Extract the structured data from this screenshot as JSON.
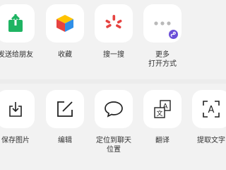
{
  "share_row": {
    "items": [
      {
        "label": "发送给朋友",
        "icon": "send-to-friend-icon"
      },
      {
        "label": "收藏",
        "icon": "favorite-cube-icon"
      },
      {
        "label": "搜一搜",
        "icon": "search-one-search-icon"
      },
      {
        "label_line1": "更多",
        "label_line2": "打开方式",
        "icon": "more-open-with-icon"
      }
    ]
  },
  "action_row": {
    "items": [
      {
        "label": "保存图片",
        "icon": "save-image-icon"
      },
      {
        "label": "编辑",
        "icon": "edit-icon"
      },
      {
        "label_line1": "定位到聊天",
        "label_line2": "位置",
        "icon": "locate-chat-icon"
      },
      {
        "label": "翻译",
        "icon": "translate-icon"
      },
      {
        "label": "提取文字",
        "icon": "extract-text-icon"
      }
    ]
  },
  "colors": {
    "send_green": "#1fb463",
    "search_red": "#e64340",
    "badge_purple": "#6b4fd8",
    "tile_bg": "#ffffff",
    "sheet_bg": "#f2f2f2"
  }
}
